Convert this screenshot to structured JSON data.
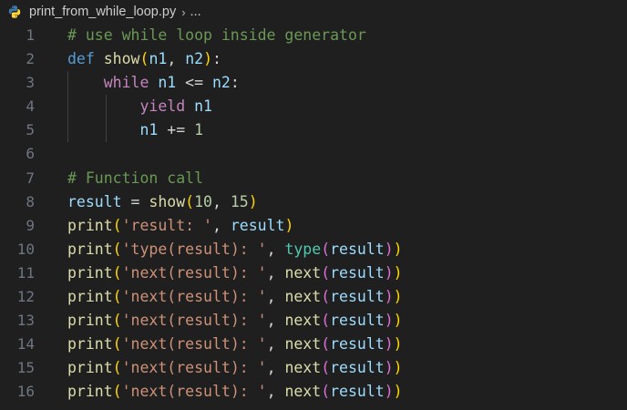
{
  "breadcrumb": {
    "file_icon": "python-icon",
    "file_name": "print_from_while_loop.py",
    "separator": "›",
    "more": "..."
  },
  "colors": {
    "background": "#1f1f1f",
    "comment": "#6a9955",
    "keyword": "#569cd6",
    "control": "#c586c0",
    "function": "#dcdcaa",
    "variable": "#9cdcfe",
    "number": "#b5cea8",
    "string": "#ce9178",
    "type": "#4ec9b0",
    "bracket_1": "#ffd700",
    "bracket_2": "#da70d6",
    "line_number": "#6e7681"
  },
  "editor": {
    "lines": [
      {
        "n": "1",
        "tokens": [
          {
            "t": "comment",
            "v": "# use while loop inside generator"
          }
        ]
      },
      {
        "n": "2",
        "tokens": [
          {
            "t": "keyword",
            "v": "def"
          },
          {
            "t": "op",
            "v": " "
          },
          {
            "t": "func",
            "v": "show"
          },
          {
            "t": "b1",
            "v": "("
          },
          {
            "t": "var",
            "v": "n1"
          },
          {
            "t": "op",
            "v": ", "
          },
          {
            "t": "var",
            "v": "n2"
          },
          {
            "t": "b1",
            "v": ")"
          },
          {
            "t": "op",
            "v": ":"
          }
        ]
      },
      {
        "n": "3",
        "tokens": [
          {
            "t": "op",
            "v": "    "
          },
          {
            "t": "control",
            "v": "while"
          },
          {
            "t": "op",
            "v": " "
          },
          {
            "t": "var",
            "v": "n1"
          },
          {
            "t": "op",
            "v": " <= "
          },
          {
            "t": "var",
            "v": "n2"
          },
          {
            "t": "op",
            "v": ":"
          }
        ]
      },
      {
        "n": "4",
        "tokens": [
          {
            "t": "op",
            "v": "        "
          },
          {
            "t": "control",
            "v": "yield"
          },
          {
            "t": "op",
            "v": " "
          },
          {
            "t": "var",
            "v": "n1"
          }
        ]
      },
      {
        "n": "5",
        "tokens": [
          {
            "t": "op",
            "v": "        "
          },
          {
            "t": "var",
            "v": "n1"
          },
          {
            "t": "op",
            "v": " += "
          },
          {
            "t": "num",
            "v": "1"
          }
        ]
      },
      {
        "n": "6",
        "tokens": []
      },
      {
        "n": "7",
        "tokens": [
          {
            "t": "comment",
            "v": "# Function call"
          }
        ]
      },
      {
        "n": "8",
        "tokens": [
          {
            "t": "var",
            "v": "result"
          },
          {
            "t": "op",
            "v": " = "
          },
          {
            "t": "func",
            "v": "show"
          },
          {
            "t": "b1",
            "v": "("
          },
          {
            "t": "num",
            "v": "10"
          },
          {
            "t": "op",
            "v": ", "
          },
          {
            "t": "num",
            "v": "15"
          },
          {
            "t": "b1",
            "v": ")"
          }
        ]
      },
      {
        "n": "9",
        "tokens": [
          {
            "t": "func",
            "v": "print"
          },
          {
            "t": "b1",
            "v": "("
          },
          {
            "t": "str",
            "v": "'result: '"
          },
          {
            "t": "op",
            "v": ", "
          },
          {
            "t": "var",
            "v": "result"
          },
          {
            "t": "b1",
            "v": ")"
          }
        ]
      },
      {
        "n": "10",
        "tokens": [
          {
            "t": "func",
            "v": "print"
          },
          {
            "t": "b1",
            "v": "("
          },
          {
            "t": "str",
            "v": "'type(result): '"
          },
          {
            "t": "op",
            "v": ", "
          },
          {
            "t": "type",
            "v": "type"
          },
          {
            "t": "b2",
            "v": "("
          },
          {
            "t": "var",
            "v": "result"
          },
          {
            "t": "b2",
            "v": ")"
          },
          {
            "t": "b1",
            "v": ")"
          }
        ]
      },
      {
        "n": "11",
        "tokens": [
          {
            "t": "func",
            "v": "print"
          },
          {
            "t": "b1",
            "v": "("
          },
          {
            "t": "str",
            "v": "'next(result): '"
          },
          {
            "t": "op",
            "v": ", "
          },
          {
            "t": "func",
            "v": "next"
          },
          {
            "t": "b2",
            "v": "("
          },
          {
            "t": "var",
            "v": "result"
          },
          {
            "t": "b2",
            "v": ")"
          },
          {
            "t": "b1",
            "v": ")"
          }
        ]
      },
      {
        "n": "12",
        "tokens": [
          {
            "t": "func",
            "v": "print"
          },
          {
            "t": "b1",
            "v": "("
          },
          {
            "t": "str",
            "v": "'next(result): '"
          },
          {
            "t": "op",
            "v": ", "
          },
          {
            "t": "func",
            "v": "next"
          },
          {
            "t": "b2",
            "v": "("
          },
          {
            "t": "var",
            "v": "result"
          },
          {
            "t": "b2",
            "v": ")"
          },
          {
            "t": "b1",
            "v": ")"
          }
        ]
      },
      {
        "n": "13",
        "tokens": [
          {
            "t": "func",
            "v": "print"
          },
          {
            "t": "b1",
            "v": "("
          },
          {
            "t": "str",
            "v": "'next(result): '"
          },
          {
            "t": "op",
            "v": ", "
          },
          {
            "t": "func",
            "v": "next"
          },
          {
            "t": "b2",
            "v": "("
          },
          {
            "t": "var",
            "v": "result"
          },
          {
            "t": "b2",
            "v": ")"
          },
          {
            "t": "b1",
            "v": ")"
          }
        ]
      },
      {
        "n": "14",
        "tokens": [
          {
            "t": "func",
            "v": "print"
          },
          {
            "t": "b1",
            "v": "("
          },
          {
            "t": "str",
            "v": "'next(result): '"
          },
          {
            "t": "op",
            "v": ", "
          },
          {
            "t": "func",
            "v": "next"
          },
          {
            "t": "b2",
            "v": "("
          },
          {
            "t": "var",
            "v": "result"
          },
          {
            "t": "b2",
            "v": ")"
          },
          {
            "t": "b1",
            "v": ")"
          }
        ]
      },
      {
        "n": "15",
        "tokens": [
          {
            "t": "func",
            "v": "print"
          },
          {
            "t": "b1",
            "v": "("
          },
          {
            "t": "str",
            "v": "'next(result): '"
          },
          {
            "t": "op",
            "v": ", "
          },
          {
            "t": "func",
            "v": "next"
          },
          {
            "t": "b2",
            "v": "("
          },
          {
            "t": "var",
            "v": "result"
          },
          {
            "t": "b2",
            "v": ")"
          },
          {
            "t": "b1",
            "v": ")"
          }
        ]
      },
      {
        "n": "16",
        "tokens": [
          {
            "t": "func",
            "v": "print"
          },
          {
            "t": "b1",
            "v": "("
          },
          {
            "t": "str",
            "v": "'next(result): '"
          },
          {
            "t": "op",
            "v": ", "
          },
          {
            "t": "func",
            "v": "next"
          },
          {
            "t": "b2",
            "v": "("
          },
          {
            "t": "var",
            "v": "result"
          },
          {
            "t": "b2",
            "v": ")"
          },
          {
            "t": "b1",
            "v": ")"
          }
        ]
      }
    ]
  }
}
